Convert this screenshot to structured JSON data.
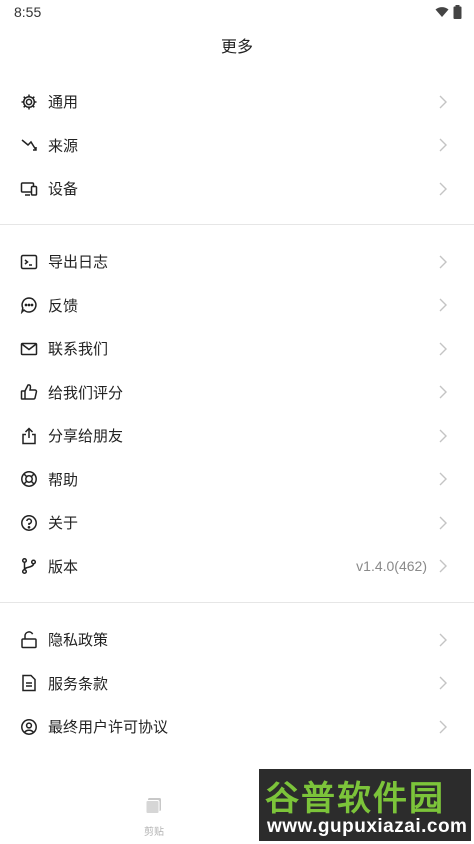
{
  "status": {
    "time": "8:55"
  },
  "header": {
    "title": "更多"
  },
  "groups": [
    {
      "items": [
        {
          "label": "通用",
          "icon": "gear-icon"
        },
        {
          "label": "来源",
          "icon": "source-route-icon"
        },
        {
          "label": "设备",
          "icon": "devices-icon"
        }
      ]
    },
    {
      "items": [
        {
          "label": "导出日志",
          "icon": "terminal-icon"
        },
        {
          "label": "反馈",
          "icon": "chat-bubble-icon"
        },
        {
          "label": "联系我们",
          "icon": "mail-icon"
        },
        {
          "label": "给我们评分",
          "icon": "thumbs-up-icon"
        },
        {
          "label": "分享给朋友",
          "icon": "share-icon"
        },
        {
          "label": "帮助",
          "icon": "lifebuoy-icon"
        },
        {
          "label": "关于",
          "icon": "question-circle-icon"
        },
        {
          "label": "版本",
          "icon": "branch-icon",
          "value": "v1.4.0(462)"
        }
      ]
    },
    {
      "items": [
        {
          "label": "隐私政策",
          "icon": "unlock-icon"
        },
        {
          "label": "服务条款",
          "icon": "document-icon"
        },
        {
          "label": "最终用户许可协议",
          "icon": "user-circle-icon"
        }
      ]
    }
  ],
  "bottom_nav": {
    "label": "剪贴"
  },
  "watermark": {
    "main": "谷普软件园",
    "url": "www.gupuxiazai.com"
  }
}
